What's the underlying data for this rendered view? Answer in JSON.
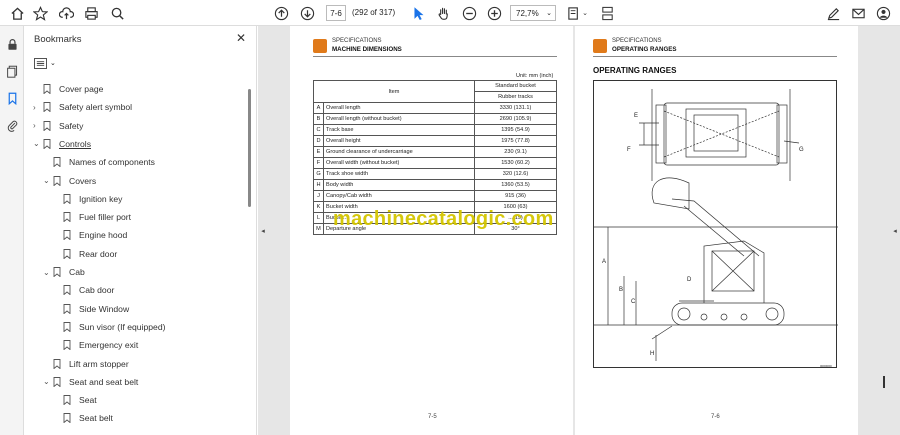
{
  "toolbar": {
    "page_input": "7-6",
    "page_count": "(292 of 317)",
    "zoom": "72,7%"
  },
  "bookmarks": {
    "title": "Bookmarks",
    "items": [
      {
        "label": "Cover page",
        "level": 0,
        "arrow": ""
      },
      {
        "label": "Safety alert symbol",
        "level": 0,
        "arrow": "›"
      },
      {
        "label": "Safety",
        "level": 0,
        "arrow": "›"
      },
      {
        "label": "Controls",
        "level": 0,
        "arrow": "⌄"
      },
      {
        "label": "Names of components",
        "level": 1,
        "arrow": ""
      },
      {
        "label": "Covers",
        "level": 1,
        "arrow": "⌄"
      },
      {
        "label": "Ignition key",
        "level": 2,
        "arrow": ""
      },
      {
        "label": "Fuel filler port",
        "level": 2,
        "arrow": ""
      },
      {
        "label": "Engine hood",
        "level": 2,
        "arrow": ""
      },
      {
        "label": "Rear door",
        "level": 2,
        "arrow": ""
      },
      {
        "label": "Cab",
        "level": 1,
        "arrow": "⌄"
      },
      {
        "label": "Cab door",
        "level": 2,
        "arrow": ""
      },
      {
        "label": "Side Window",
        "level": 2,
        "arrow": ""
      },
      {
        "label": "Sun visor (If equipped)",
        "level": 2,
        "arrow": ""
      },
      {
        "label": "Emergency exit",
        "level": 2,
        "arrow": ""
      },
      {
        "label": "Lift arm stopper",
        "level": 1,
        "arrow": ""
      },
      {
        "label": "Seat and seat belt",
        "level": 1,
        "arrow": "⌄"
      },
      {
        "label": "Seat",
        "level": 2,
        "arrow": ""
      },
      {
        "label": "Seat belt",
        "level": 2,
        "arrow": ""
      }
    ]
  },
  "left_page": {
    "header_small": "SPECIFICATIONS",
    "header_big": "MACHINE DIMENSIONS",
    "unit": "Unit: mm (inch)",
    "col_item": "Item",
    "col_standard": "Standard bucket",
    "col_rubber": "Rubber tracks",
    "rows": [
      {
        "key": "A",
        "item": "Overall length",
        "value": "3330 (131.1)"
      },
      {
        "key": "B",
        "item": "Overall length (without bucket)",
        "value": "2690 (105.9)"
      },
      {
        "key": "C",
        "item": "Track base",
        "value": "1395 (54.9)"
      },
      {
        "key": "D",
        "item": "Overall height",
        "value": "1975 (77.8)"
      },
      {
        "key": "E",
        "item": "Ground clearance of undercarriage",
        "value": "230 (9.1)"
      },
      {
        "key": "F",
        "item": "Overall width (without bucket)",
        "value": "1530 (60.2)"
      },
      {
        "key": "G",
        "item": "Track shoe width",
        "value": "320 (12.6)"
      },
      {
        "key": "H",
        "item": "Body width",
        "value": "1360 (53.5)"
      },
      {
        "key": "J",
        "item": "Canopy/Cab width",
        "value": "915 (36)"
      },
      {
        "key": "K",
        "item": "Bucket width",
        "value": "1600 (63)"
      },
      {
        "key": "L",
        "item": "Bucket...",
        "value": "...(19)"
      },
      {
        "key": "M",
        "item": "Departure angle",
        "value": "30°"
      }
    ],
    "page_number": "7-5"
  },
  "right_page": {
    "header_small": "SPECIFICATIONS",
    "header_big": "OPERATING RANGES",
    "section_title": "OPERATING RANGES",
    "labels": {
      "A": "A",
      "B": "B",
      "C": "C",
      "D": "D",
      "E": "E",
      "F": "F",
      "G": "G",
      "H": "H"
    },
    "fig_id": "0000000",
    "page_number": "7-6"
  },
  "watermark": "machinecatalogic.com",
  "colors": {
    "logo": "#e07a1a",
    "watermark": "#d4c600",
    "accent": "#1a73e8"
  }
}
